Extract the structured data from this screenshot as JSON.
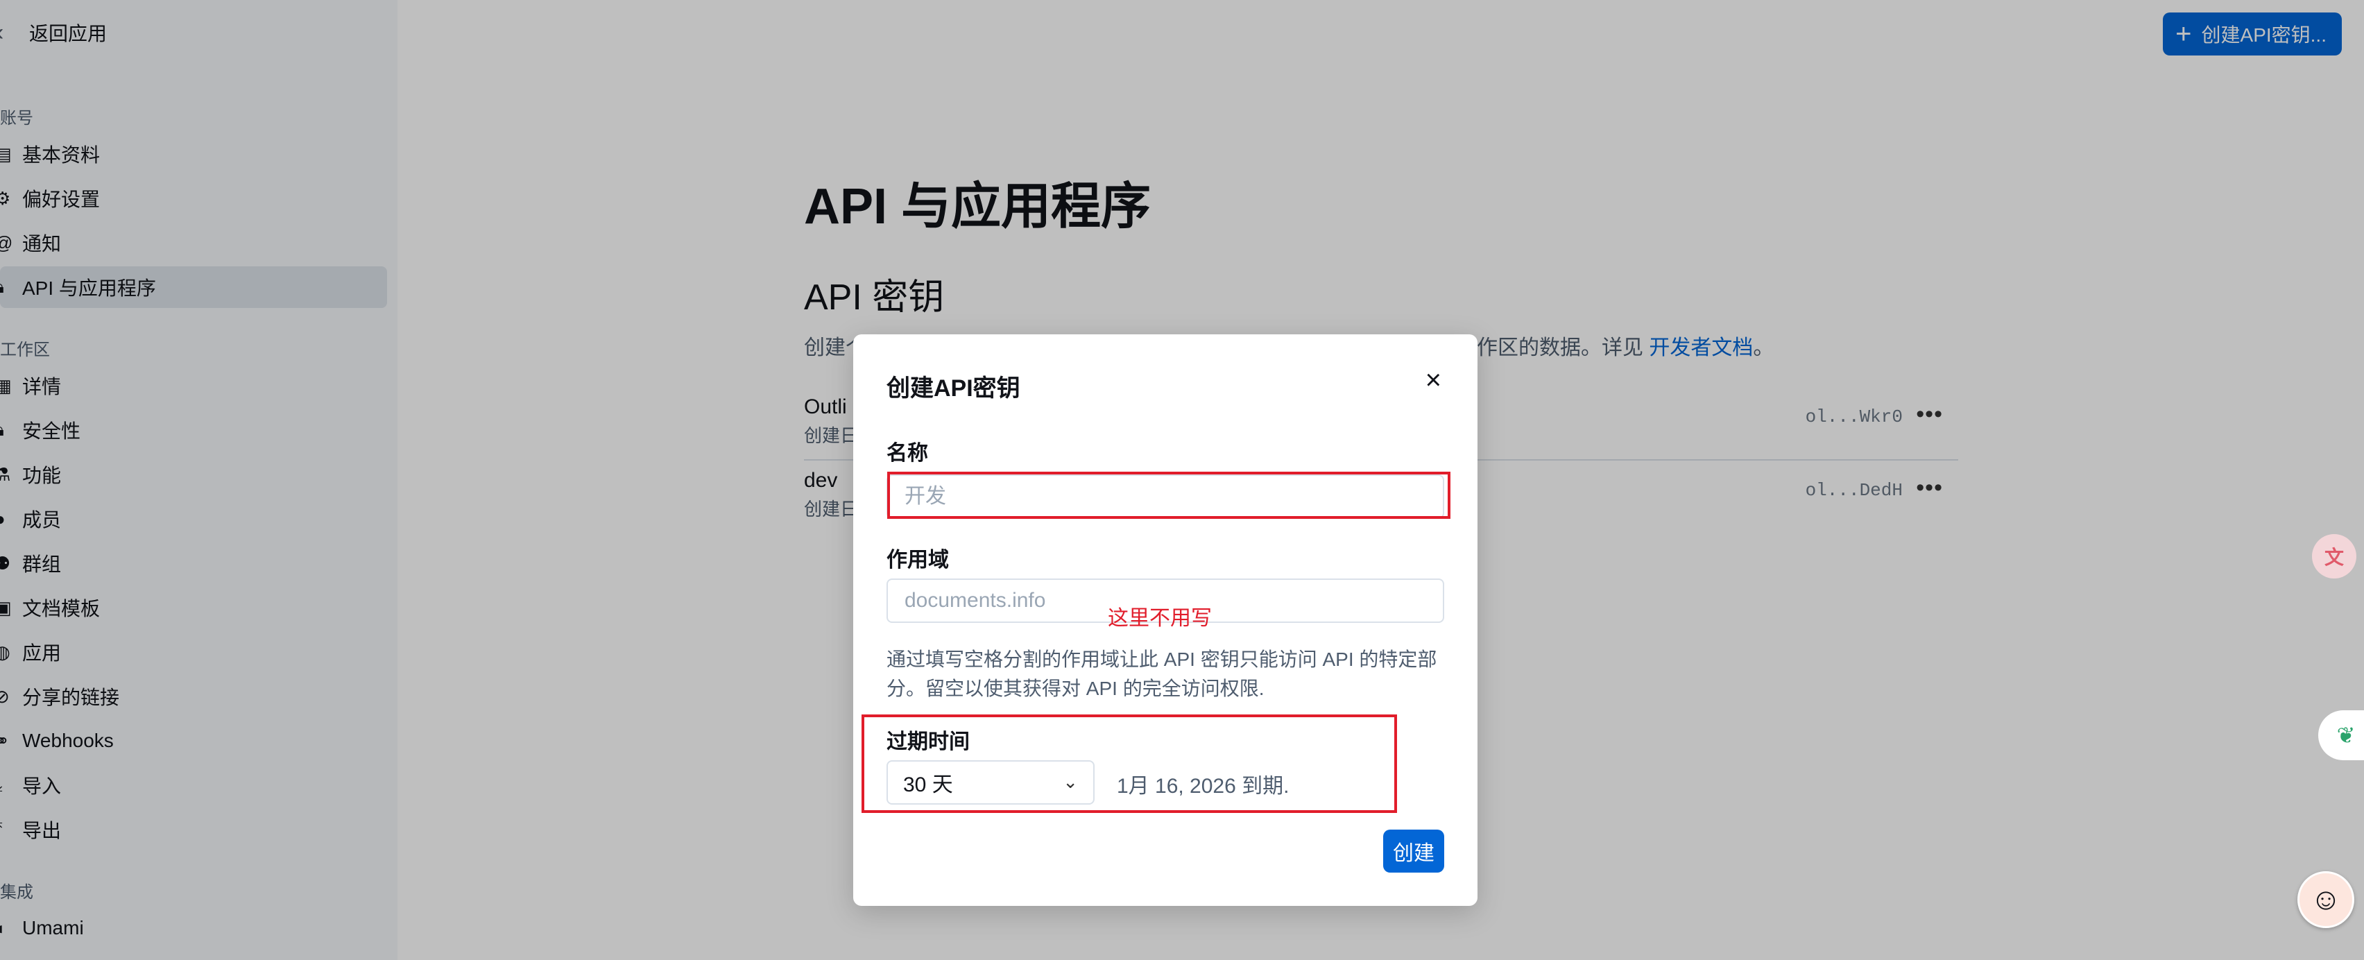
{
  "sidebar": {
    "back_label": "返回应用",
    "sections": {
      "account": "账号",
      "workspace": "工作区",
      "integrations": "集成"
    },
    "account_items": [
      {
        "icon": "profile-card-icon",
        "label": "基本资料"
      },
      {
        "icon": "gear-icon",
        "label": "偏好设置"
      },
      {
        "icon": "at-sign-icon",
        "label": "通知"
      },
      {
        "icon": "lock-icon",
        "label": "API 与应用程序",
        "active": true
      }
    ],
    "workspace_items": [
      {
        "icon": "grid-icon",
        "label": "详情"
      },
      {
        "icon": "padlock-icon",
        "label": "安全性"
      },
      {
        "icon": "beaker-icon",
        "label": "功能"
      },
      {
        "icon": "user-icon",
        "label": "成员"
      },
      {
        "icon": "group-icon",
        "label": "群组"
      },
      {
        "icon": "template-icon",
        "label": "文档模板"
      },
      {
        "icon": "globe-icon",
        "label": "应用"
      },
      {
        "icon": "share-link-icon",
        "label": "分享的链接"
      },
      {
        "icon": "webhooks-icon",
        "label": "Webhooks"
      },
      {
        "icon": "download-icon",
        "label": "导入"
      },
      {
        "icon": "upload-icon",
        "label": "导出"
      }
    ],
    "integration_items": [
      {
        "icon": "umami-icon",
        "label": "Umami"
      }
    ]
  },
  "header": {
    "create_button_label": "创建API密钥..."
  },
  "page": {
    "title": "API 与应用程序",
    "section_title": "API 密钥",
    "description_start": "创建个",
    "description_end": "的工作区的数据。详见 ",
    "description_link": "开发者文档",
    "description_period": "。"
  },
  "keys": [
    {
      "name": "Outli",
      "sub": "创建日",
      "masked": "ol...Wkr0"
    },
    {
      "name": "dev",
      "sub": "创建日",
      "masked": "ol...DedH"
    }
  ],
  "modal": {
    "title": "创建API密钥",
    "name_label": "名称",
    "name_placeholder": "开发",
    "scope_label": "作用域",
    "scope_placeholder": "documents.info",
    "scope_help": "通过填写空格分割的作用域让此 API 密钥只能访问 API 的特定部分。留空以使其获得对 API 的完全访问权限.",
    "expiry_label": "过期时间",
    "expiry_value": "30 天",
    "expiry_text": "1月 16, 2026 到期.",
    "create_label": "创建"
  },
  "annotations": {
    "scope_note": "这里不用写"
  },
  "colors": {
    "accent": "#0366d6",
    "annotation": "#e11d2b",
    "sidebar_bg": "#f4f7fa",
    "overlay": "rgba(0,0,0,0.25)"
  }
}
